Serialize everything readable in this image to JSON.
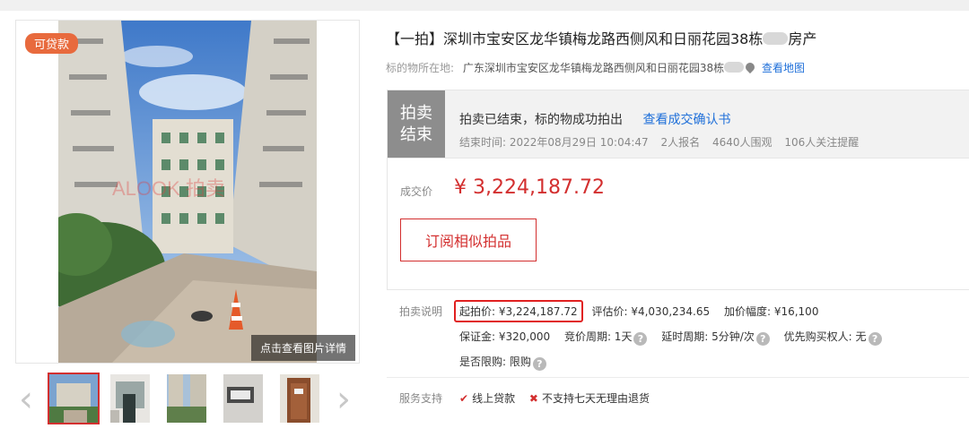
{
  "badge": {
    "loan": "可贷款"
  },
  "photo": {
    "view_details": "点击查看图片详情",
    "watermark": "ALOOK 拍卖"
  },
  "gallery": {
    "prev": "‹",
    "next": "›"
  },
  "title": {
    "prefix": "【一拍】深圳市宝安区龙华镇梅龙路西侧风和日丽花园38栋",
    "suffix": "房产"
  },
  "location": {
    "label": "标的物所在地:",
    "address": "广东深圳市宝安区龙华镇梅龙路西侧风和日丽花园38栋",
    "map_link": "查看地图"
  },
  "status": {
    "tag_line1": "拍卖",
    "tag_line2": "结束",
    "message": "拍卖已结束，标的物成功拍出",
    "confirm_link": "查看成交确认书",
    "end_time": "结束时间: 2022年08月29日 10:04:47",
    "signups": "2人报名",
    "views": "4640人围观",
    "followers": "106人关注提醒"
  },
  "deal": {
    "label": "成交价",
    "price": "¥ 3,224,187.72",
    "subscribe": "订阅相似拍品"
  },
  "auction": {
    "label": "拍卖说明",
    "start_price": "起拍价: ¥3,224,187.72",
    "appraisal": "评估价: ¥4,030,234.65",
    "increment": "加价幅度: ¥16,100",
    "deposit": "保证金: ¥320,000",
    "cycle": "竞价周期: 1天",
    "delay": "延时周期: 5分钟/次",
    "priority": "优先购买权人: 无",
    "restricted": "是否限购: 限购"
  },
  "service": {
    "label": "服务支持",
    "loan": "线上贷款",
    "no_return": "不支持七天无理由退货"
  },
  "colors": {
    "accent": "#d32f2f",
    "link": "#1e6fd9",
    "badge": "#e86a3d",
    "status_tag": "#8d8d8d"
  }
}
